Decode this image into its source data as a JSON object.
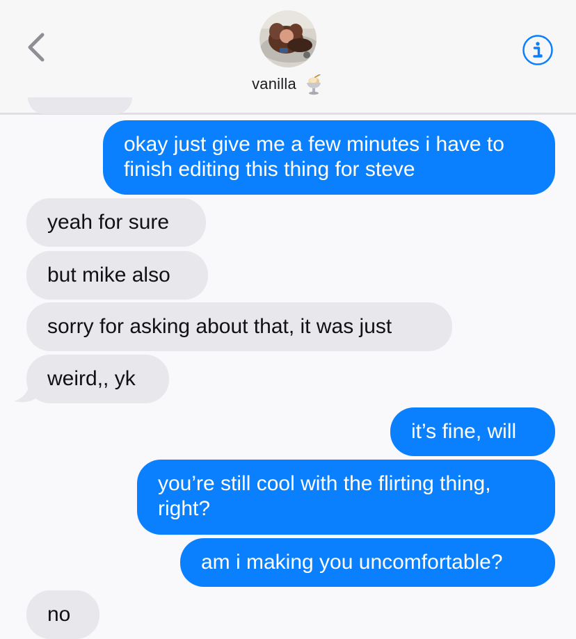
{
  "header": {
    "contact_name": "vanilla",
    "back_icon": "chevron-left-icon",
    "info_icon": "info-icon",
    "dessert_icon": "ice-cream-sundae-icon"
  },
  "colors": {
    "outgoing_bubble": "#0b80ff",
    "incoming_bubble": "#e7e7ec",
    "accent": "#0b80ff"
  },
  "messages": [
    {
      "direction": "outgoing",
      "text": "okay just give me a few minutes i have to\nfinish editing this thing for steve"
    },
    {
      "direction": "incoming",
      "text": "yeah for sure"
    },
    {
      "direction": "incoming",
      "text": "but mike also"
    },
    {
      "direction": "incoming",
      "text": "sorry for asking about that, it was just"
    },
    {
      "direction": "incoming",
      "text": "weird,, yk"
    },
    {
      "direction": "outgoing",
      "text": "it’s fine, will"
    },
    {
      "direction": "outgoing",
      "text": "you’re still cool with the flirting thing,\nright?"
    },
    {
      "direction": "outgoing",
      "text": "am i making you uncomfortable?"
    },
    {
      "direction": "incoming",
      "text": "no"
    }
  ]
}
